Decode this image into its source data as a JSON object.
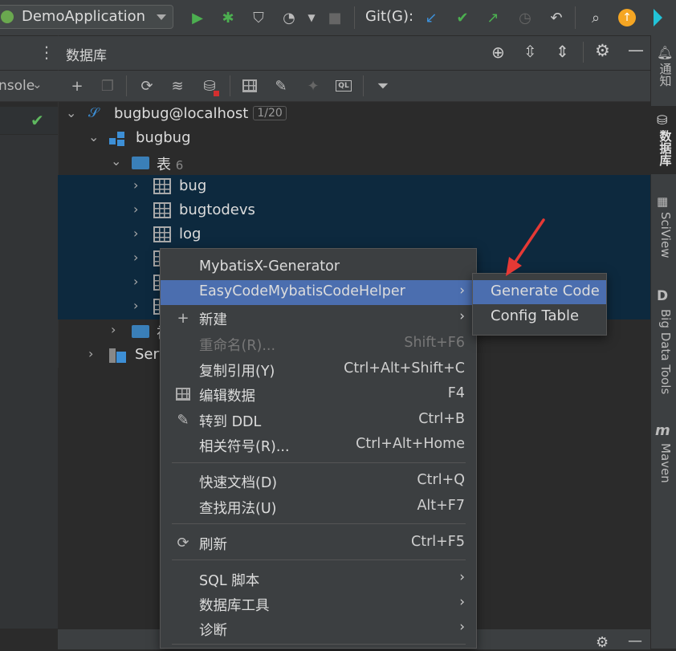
{
  "toolbar": {
    "run_config": "DemoApplication",
    "git_label": "Git(G):"
  },
  "left_panel": {
    "console_label": "nsole"
  },
  "db_panel": {
    "title": "数据库",
    "tree": {
      "connection": {
        "label": "bugbug@localhost",
        "badge": "1/20"
      },
      "schema": {
        "label": "bugbug"
      },
      "tables_folder": {
        "label": "表",
        "count": "6"
      },
      "tables": [
        "bug",
        "bugtodevs",
        "log"
      ],
      "partial_folder_label": "视",
      "server_label": "Serv"
    }
  },
  "right_strip": {
    "tabs": [
      "通知",
      "数据库",
      "SciView",
      "Big Data Tools",
      "Maven"
    ]
  },
  "context_menu": {
    "items": [
      {
        "label": "MybatisX-Generator"
      },
      {
        "label": "EasyCodeMybatisCodeHelper",
        "arrow": "›"
      },
      {
        "label": "新建",
        "arrow": "›"
      },
      {
        "label": "重命名(R)...",
        "shortcut": "Shift+F6"
      },
      {
        "label": "复制引用(Y)",
        "shortcut": "Ctrl+Alt+Shift+C"
      },
      {
        "label": "编辑数据",
        "shortcut": "F4"
      },
      {
        "label": "转到 DDL",
        "shortcut": "Ctrl+B"
      },
      {
        "label": "相关符号(R)...",
        "shortcut": "Ctrl+Alt+Home"
      },
      {
        "label": "快速文档(D)",
        "shortcut": "Ctrl+Q"
      },
      {
        "label": "查找用法(U)",
        "shortcut": "Alt+F7"
      },
      {
        "label": "刷新",
        "shortcut": "Ctrl+F5"
      },
      {
        "label": "SQL 脚本",
        "arrow": "›"
      },
      {
        "label": "数据库工具",
        "arrow": "›"
      },
      {
        "label": "诊断",
        "arrow": "›"
      }
    ]
  },
  "submenu": {
    "items": [
      "Generate Code",
      "Config Table"
    ]
  },
  "colors": {
    "menu_highlight": "#4b6eaf",
    "selection": "#0d293e",
    "annotation_arrow": "#e53935"
  }
}
